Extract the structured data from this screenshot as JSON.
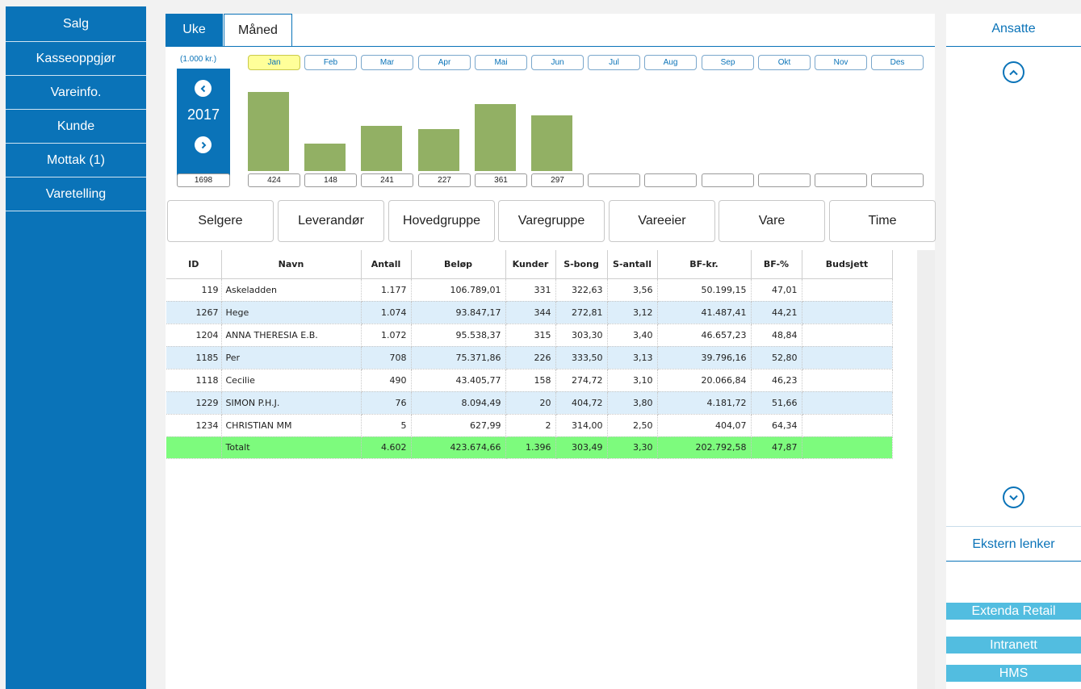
{
  "sidebar": {
    "items": [
      {
        "label": "Salg"
      },
      {
        "label": "Kasseoppgjør"
      },
      {
        "label": "Vareinfo."
      },
      {
        "label": "Kunde"
      },
      {
        "label": "Mottak (1)"
      },
      {
        "label": "Varetelling"
      }
    ]
  },
  "chart_panel": {
    "tabs": [
      {
        "label": "Uke"
      },
      {
        "label": "Måned"
      }
    ],
    "active_tab": "Måned",
    "unit": "(1.000 kr.)",
    "year": "2017",
    "year_total": "1698",
    "prev_icon": "chevron-left-icon",
    "next_icon": "chevron-right-icon"
  },
  "chart_data": {
    "type": "bar",
    "categories": [
      "Jan",
      "Feb",
      "Mar",
      "Apr",
      "Mai",
      "Jun",
      "Jul",
      "Aug",
      "Sep",
      "Okt",
      "Nov",
      "Des"
    ],
    "values": [
      424,
      148,
      241,
      227,
      361,
      297,
      null,
      null,
      null,
      null,
      null,
      null
    ],
    "value_labels": [
      "424",
      "148",
      "241",
      "227",
      "361",
      "297",
      "",
      "",
      "",
      "",
      "",
      ""
    ],
    "selected": "Jan",
    "ylim": [
      0,
      500
    ],
    "bar_color": "#92b064"
  },
  "categories_bar": {
    "buttons": [
      {
        "label": "Selgere"
      },
      {
        "label": "Leverandør"
      },
      {
        "label": "Hovedgruppe"
      },
      {
        "label": "Varegruppe"
      },
      {
        "label": "Vareeier"
      },
      {
        "label": "Vare"
      },
      {
        "label": "Time"
      }
    ]
  },
  "table": {
    "columns": [
      "ID",
      "Navn",
      "Antall",
      "Beløp",
      "Kunder",
      "S-bong",
      "S-antall",
      "BF-kr.",
      "BF-%",
      "Budsjett"
    ],
    "rows": [
      [
        "119",
        "Askeladden",
        "1.177",
        "106.789,01",
        "331",
        "322,63",
        "3,56",
        "50.199,15",
        "47,01",
        ""
      ],
      [
        "1267",
        "Hege",
        "1.074",
        "93.847,17",
        "344",
        "272,81",
        "3,12",
        "41.487,41",
        "44,21",
        ""
      ],
      [
        "1204",
        "ANNA THERESIA E.B.",
        "1.072",
        "95.538,37",
        "315",
        "303,30",
        "3,40",
        "46.657,23",
        "48,84",
        ""
      ],
      [
        "1185",
        "Per",
        "708",
        "75.371,86",
        "226",
        "333,50",
        "3,13",
        "39.796,16",
        "52,80",
        ""
      ],
      [
        "1118",
        "Cecilie",
        "490",
        "43.405,77",
        "158",
        "274,72",
        "3,10",
        "20.066,84",
        "46,23",
        ""
      ],
      [
        "1229",
        "SIMON P.H.J.",
        "76",
        "8.094,49",
        "20",
        "404,72",
        "3,80",
        "4.181,72",
        "51,66",
        ""
      ],
      [
        "1234",
        "CHRISTIAN MM",
        "5",
        "627,99",
        "2",
        "314,00",
        "2,50",
        "404,07",
        "64,34",
        ""
      ]
    ],
    "total": [
      "",
      "Totalt",
      "4.602",
      "423.674,66",
      "1.396",
      "303,49",
      "3,30",
      "202.792,58",
      "47,87",
      ""
    ]
  },
  "right_panel": {
    "title": "Ansatte",
    "scroll_up_icon": "chevron-up-circle-icon",
    "scroll_down_icon": "chevron-down-circle-icon",
    "links_title": "Ekstern lenker",
    "links": [
      {
        "label": "Extenda Retail"
      },
      {
        "label": "Intranett"
      },
      {
        "label": "HMS"
      }
    ]
  },
  "colors": {
    "primary": "#0a73b8",
    "bar": "#92b064",
    "selected_month": "#ffff99",
    "row_alt": "#ddeefa",
    "total_row": "#7dfb7d",
    "link_button": "#52bde0"
  }
}
